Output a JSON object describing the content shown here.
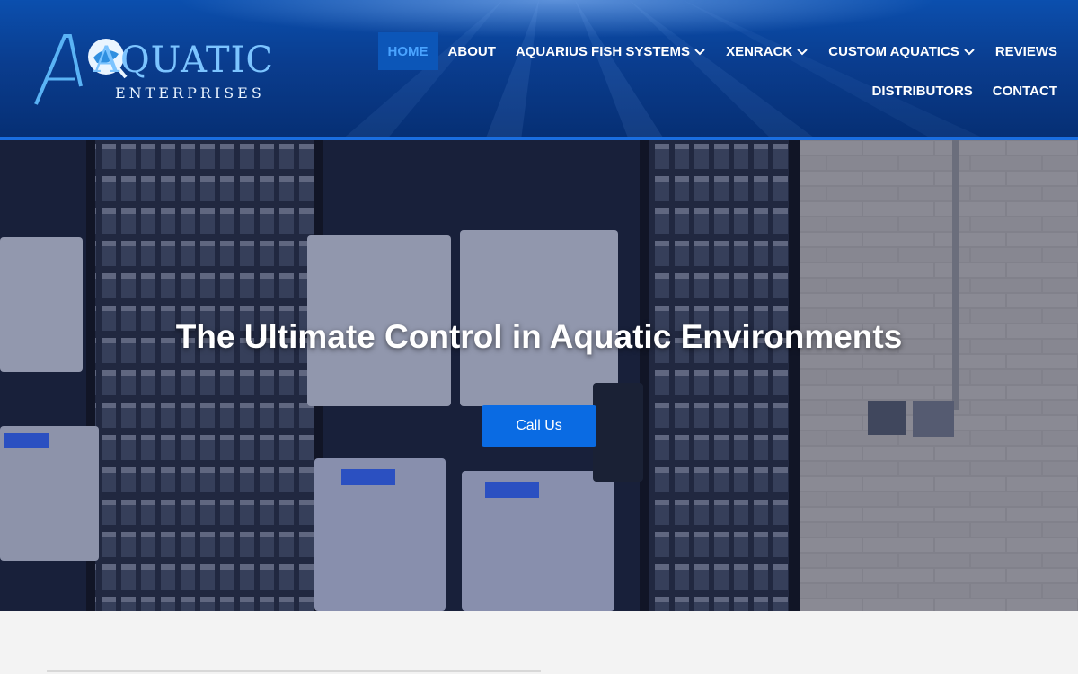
{
  "logo": {
    "title": "AQUATIC",
    "subtitle": "ENTERPRISES"
  },
  "nav": {
    "row1": [
      {
        "label": "HOME",
        "active": true,
        "dropdown": false
      },
      {
        "label": "ABOUT",
        "active": false,
        "dropdown": false
      },
      {
        "label": "AQUARIUS FISH SYSTEMS",
        "active": false,
        "dropdown": true
      },
      {
        "label": "XENRACK",
        "active": false,
        "dropdown": true
      },
      {
        "label": "CUSTOM AQUATICS",
        "active": false,
        "dropdown": true
      },
      {
        "label": "REVIEWS",
        "active": false,
        "dropdown": false
      }
    ],
    "row2": [
      {
        "label": "DISTRIBUTORS",
        "active": false,
        "dropdown": false
      },
      {
        "label": "CONTACT",
        "active": false,
        "dropdown": false
      }
    ]
  },
  "hero": {
    "title": "The Ultimate Control in Aquatic Environments",
    "cta_label": "Call Us"
  },
  "colors": {
    "header_blue": "#0a3d8f",
    "active_nav_text": "#49a3ff",
    "cta_blue": "#0a6be3"
  }
}
